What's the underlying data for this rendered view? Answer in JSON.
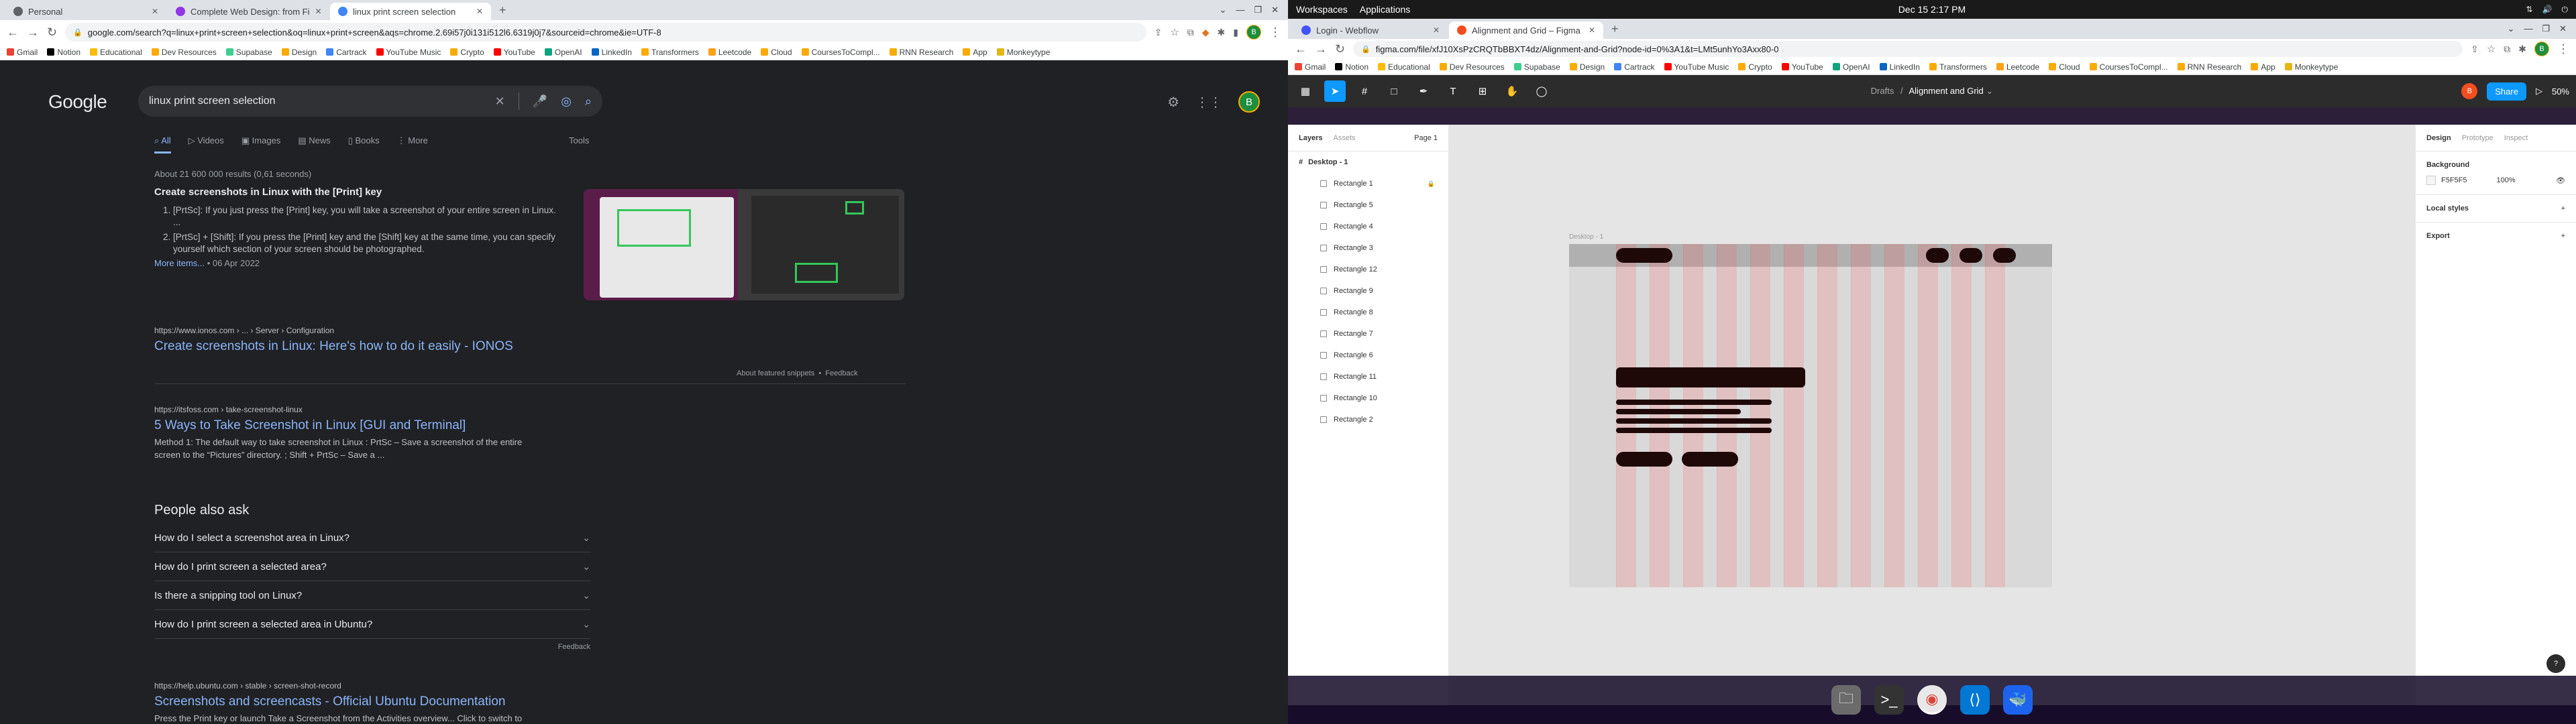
{
  "left": {
    "tabs": [
      {
        "title": "Personal",
        "color": "#5f6368"
      },
      {
        "title": "Complete Web Design: from Fi",
        "color": "#9334e6"
      },
      {
        "title": "linux print screen selection",
        "color": "#4285f4"
      }
    ],
    "url": "google.com/search?q=linux+print+screen+selection&oq=linux+print+screen&aqs=chrome.2.69i57j0i131i512l6.6319j0j7&sourceid=chrome&ie=UTF-8",
    "bookmarks": [
      "Gmail",
      "Notion",
      "Educational",
      "Dev Resources",
      "Supabase",
      "Design",
      "Cartrack",
      "YouTube Music",
      "Crypto",
      "YouTube",
      "OpenAI",
      "LinkedIn",
      "Transformers",
      "Leetcode",
      "Cloud",
      "CoursesToCompl...",
      "RNN Research",
      "App",
      "Monkeytype"
    ],
    "google": {
      "logo": "Google",
      "query": "linux print screen selection",
      "avatar": "B",
      "tabs": [
        "All",
        "Videos",
        "Images",
        "News",
        "Books",
        "More"
      ],
      "tools": "Tools",
      "stats": "About 21 600 000 results (0,61 seconds)",
      "featured": {
        "title": "Create screenshots in Linux with the [Print] key",
        "items": [
          "[PrtSc]: If you just press the [Print] key, you will take a screenshot of your entire screen in Linux. ...",
          "[PrtSc] + [Shift]: If you press the [Print] key and the [Shift] key at the same time, you can specify yourself which section of your screen should be photographed."
        ],
        "more": "More items...",
        "date": "• 06 Apr 2022",
        "source_url": "https://www.ionos.com › ... › Server › Configuration",
        "link": "Create screenshots in Linux: Here's how to do it easily - IONOS",
        "about": "About featured snippets",
        "feedback": "Feedback"
      },
      "result2": {
        "url": "https://itsfoss.com › take-screenshot-linux",
        "title": "5 Ways to Take Screenshot in Linux [GUI and Terminal]",
        "snippet": "Method 1: The default way to take screenshot in Linux : PrtSc – Save a screenshot of the entire screen to the “Pictures” directory. ; Shift + PrtSc – Save a ..."
      },
      "paa": {
        "title": "People also ask",
        "questions": [
          "How do I select a screenshot area in Linux?",
          "How do I print screen a selected area?",
          "Is there a snipping tool on Linux?",
          "How do I print screen a selected area in Ubuntu?"
        ],
        "feedback": "Feedback"
      },
      "result3": {
        "url": "https://help.ubuntu.com › stable › screen-shot-record",
        "title": "Screenshots and screencasts - Official Ubuntu Documentation",
        "snippet": "Press the Print key or launch Take a Screenshot from the Activities overview... Click to switch to"
      }
    }
  },
  "right": {
    "topbar": {
      "workspaces": "Workspaces",
      "applications": "Applications",
      "clock": "Dec 15  2:17 PM"
    },
    "tabs": [
      {
        "title": "Login - Webflow",
        "color": "#4353ff"
      },
      {
        "title": "Alignment and Grid – Figma",
        "color": "#f24e1e"
      }
    ],
    "url": "figma.com/file/xfJ10XsPzCRQTbBBXT4dz/Alignment-and-Grid?node-id=0%3A1&t=LMt5unhYo3Axx80-0",
    "bookmarks": [
      "Gmail",
      "Notion",
      "Educational",
      "Dev Resources",
      "Supabase",
      "Design",
      "Cartrack",
      "YouTube Music",
      "Crypto",
      "YouTube",
      "OpenAI",
      "LinkedIn",
      "Transformers",
      "Leetcode",
      "Cloud",
      "CoursesToCompl...",
      "RNN Research",
      "App",
      "Monkeytype"
    ],
    "figma": {
      "breadcrumb_drafts": "Drafts",
      "file_name": "Alignment and Grid",
      "share": "Share",
      "zoom": "50%",
      "panel_tabs": [
        "Layers",
        "Assets"
      ],
      "page": "Page 1",
      "frame_name": "Desktop - 1",
      "frame_label": "Desktop - 1",
      "layers": [
        "Rectangle 1",
        "Rectangle 5",
        "Rectangle 4",
        "Rectangle 3",
        "Rectangle 12",
        "Rectangle 9",
        "Rectangle 8",
        "Rectangle 7",
        "Rectangle 6",
        "Rectangle 11",
        "Rectangle 10",
        "Rectangle 2"
      ],
      "right_tabs": [
        "Design",
        "Prototype",
        "Inspect"
      ],
      "background_label": "Background",
      "bg_hex": "F5F5F5",
      "bg_opacity": "100%",
      "local_styles": "Local styles",
      "export": "Export"
    },
    "dock": [
      "files-icon",
      "terminal-icon",
      "chrome-icon",
      "vscode-icon",
      "docker-icon"
    ]
  }
}
